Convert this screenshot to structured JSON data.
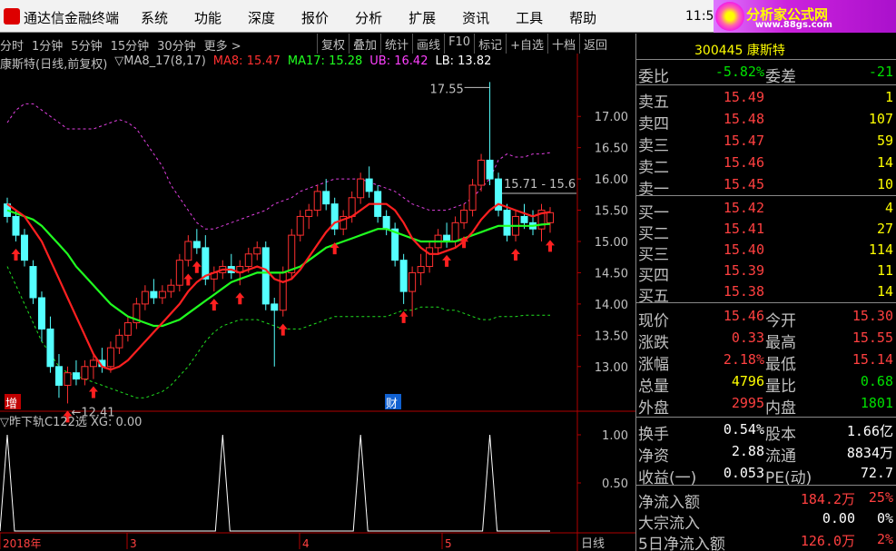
{
  "titlebar": {
    "app_title": "通达信金融终端",
    "menu": [
      "系统",
      "功能",
      "深度",
      "报价",
      "分析",
      "扩展",
      "资讯",
      "工具",
      "帮助"
    ],
    "clock": "11:5",
    "brand_name": "分析家公式网",
    "brand_url": "www.88gs.com"
  },
  "toolbar": {
    "periods": [
      "分时",
      "1分钟",
      "5分钟",
      "15分钟",
      "30分钟",
      "更多 >"
    ],
    "buttons": [
      "复权",
      "叠加",
      "统计",
      "画线",
      "F10",
      "标记",
      "+自选",
      "十档",
      "返回"
    ]
  },
  "legend": {
    "stock": "康斯特(日线,前复权)",
    "indicator": "▽MA8_17(8,17)",
    "ma8": "MA8: 15.47",
    "ma17": "MA17: 15.28",
    "ub": "UB: 16.42",
    "lb": "LB: 13.82"
  },
  "chart": {
    "price_ticks": [
      "17.00",
      "16.50",
      "16.00",
      "15.50",
      "15.00",
      "14.50",
      "14.00",
      "13.50",
      "13.00"
    ],
    "high_label": "17.55",
    "low_label": "12.41",
    "range_label": "15.71 - 15.6",
    "zeng_tag": "增",
    "cai_tag": "财",
    "sub_legend": "▽昨下轨C122选 XG: 0.00",
    "sub_ticks": [
      "1.00",
      "0.50"
    ],
    "dates": [
      "2018年",
      "3",
      "4",
      "5"
    ],
    "period_label": "日线"
  },
  "chart_data": {
    "type": "candlestick",
    "title": "康斯特(日线,前复权)",
    "ylim": [
      12.3,
      17.7
    ],
    "candles": [
      [
        15.6,
        15.7,
        15.3,
        15.4
      ],
      [
        15.4,
        15.5,
        15.0,
        15.1
      ],
      [
        15.1,
        15.2,
        14.6,
        14.7
      ],
      [
        14.6,
        14.7,
        14.0,
        14.1
      ],
      [
        14.1,
        14.2,
        13.4,
        13.6
      ],
      [
        13.6,
        13.8,
        12.9,
        13.0
      ],
      [
        13.0,
        13.2,
        12.5,
        12.7
      ],
      [
        12.7,
        13.0,
        12.41,
        12.9
      ],
      [
        12.9,
        13.1,
        12.7,
        12.8
      ],
      [
        12.8,
        13.1,
        12.7,
        13.0
      ],
      [
        13.0,
        13.2,
        12.8,
        13.1
      ],
      [
        13.1,
        13.3,
        12.9,
        13.0
      ],
      [
        13.0,
        13.4,
        12.9,
        13.3
      ],
      [
        13.3,
        13.6,
        13.2,
        13.5
      ],
      [
        13.5,
        13.8,
        13.4,
        13.7
      ],
      [
        13.7,
        14.1,
        13.6,
        14.0
      ],
      [
        14.0,
        14.3,
        13.9,
        14.2
      ],
      [
        14.2,
        14.4,
        14.0,
        14.1
      ],
      [
        14.1,
        14.3,
        14.0,
        14.2
      ],
      [
        14.2,
        14.4,
        14.1,
        14.3
      ],
      [
        14.3,
        14.8,
        14.2,
        14.7
      ],
      [
        14.7,
        15.1,
        14.6,
        15.0
      ],
      [
        15.0,
        15.2,
        14.8,
        14.9
      ],
      [
        14.9,
        15.1,
        14.3,
        14.4
      ],
      [
        14.4,
        14.6,
        14.2,
        14.5
      ],
      [
        14.5,
        14.7,
        14.4,
        14.6
      ],
      [
        14.6,
        14.8,
        14.4,
        14.5
      ],
      [
        14.5,
        14.7,
        14.3,
        14.6
      ],
      [
        14.6,
        14.9,
        14.5,
        14.8
      ],
      [
        14.8,
        15.0,
        14.7,
        14.9
      ],
      [
        14.9,
        15.0,
        13.9,
        14.0
      ],
      [
        14.0,
        14.1,
        13.0,
        13.9
      ],
      [
        13.9,
        14.6,
        13.8,
        14.5
      ],
      [
        14.5,
        15.2,
        14.4,
        15.1
      ],
      [
        15.1,
        15.5,
        15.0,
        15.4
      ],
      [
        15.4,
        15.6,
        15.2,
        15.5
      ],
      [
        15.5,
        15.9,
        15.4,
        15.8
      ],
      [
        15.8,
        16.0,
        15.5,
        15.6
      ],
      [
        15.6,
        15.7,
        15.1,
        15.2
      ],
      [
        15.2,
        15.5,
        15.1,
        15.4
      ],
      [
        15.4,
        15.8,
        15.3,
        15.7
      ],
      [
        15.7,
        16.1,
        15.6,
        16.0
      ],
      [
        16.0,
        16.2,
        15.7,
        15.8
      ],
      [
        15.8,
        15.9,
        15.3,
        15.4
      ],
      [
        15.4,
        15.5,
        15.1,
        15.2
      ],
      [
        15.2,
        15.3,
        14.6,
        14.7
      ],
      [
        14.7,
        14.8,
        14.0,
        14.2
      ],
      [
        14.2,
        14.6,
        13.8,
        14.5
      ],
      [
        14.5,
        14.8,
        14.3,
        14.6
      ],
      [
        14.6,
        15.0,
        14.5,
        14.9
      ],
      [
        14.9,
        15.2,
        14.8,
        15.1
      ],
      [
        15.1,
        15.3,
        14.9,
        15.0
      ],
      [
        15.0,
        15.4,
        14.9,
        15.3
      ],
      [
        15.3,
        15.6,
        15.2,
        15.5
      ],
      [
        15.5,
        16.0,
        15.4,
        15.9
      ],
      [
        15.9,
        16.4,
        15.8,
        16.3
      ],
      [
        16.3,
        17.55,
        15.9,
        16.0
      ],
      [
        16.0,
        16.1,
        15.4,
        15.5
      ],
      [
        15.5,
        15.6,
        15.0,
        15.1
      ],
      [
        15.1,
        15.5,
        15.0,
        15.4
      ],
      [
        15.4,
        15.6,
        15.2,
        15.3
      ],
      [
        15.3,
        15.5,
        15.1,
        15.2
      ],
      [
        15.2,
        15.6,
        15.0,
        15.5
      ],
      [
        15.3,
        15.55,
        15.14,
        15.46
      ]
    ],
    "series": [
      {
        "name": "MA8",
        "values": [
          15.6,
          15.5,
          15.4,
          15.2,
          15.0,
          14.7,
          14.4,
          14.1,
          13.8,
          13.5,
          13.2,
          13.0,
          12.95,
          13.0,
          13.1,
          13.25,
          13.4,
          13.55,
          13.7,
          13.85,
          14.0,
          14.2,
          14.35,
          14.45,
          14.5,
          14.55,
          14.55,
          14.5,
          14.55,
          14.6,
          14.55,
          14.4,
          14.35,
          14.4,
          14.55,
          14.75,
          14.95,
          15.15,
          15.3,
          15.35,
          15.4,
          15.5,
          15.6,
          15.6,
          15.6,
          15.5,
          15.3,
          15.05,
          14.9,
          14.8,
          14.8,
          14.85,
          14.9,
          15.0,
          15.15,
          15.35,
          15.5,
          15.6,
          15.55,
          15.5,
          15.45,
          15.4,
          15.45,
          15.47
        ]
      },
      {
        "name": "MA17",
        "values": [
          15.5,
          15.45,
          15.4,
          15.35,
          15.25,
          15.1,
          14.95,
          14.8,
          14.6,
          14.45,
          14.3,
          14.15,
          14.0,
          13.9,
          13.8,
          13.75,
          13.7,
          13.65,
          13.65,
          13.7,
          13.75,
          13.85,
          13.95,
          14.05,
          14.15,
          14.25,
          14.35,
          14.4,
          14.45,
          14.5,
          14.5,
          14.5,
          14.5,
          14.55,
          14.6,
          14.7,
          14.8,
          14.9,
          14.95,
          15.0,
          15.05,
          15.1,
          15.15,
          15.2,
          15.2,
          15.15,
          15.1,
          15.05,
          15.0,
          15.0,
          15.0,
          15.0,
          15.0,
          15.05,
          15.1,
          15.15,
          15.2,
          15.25,
          15.25,
          15.25,
          15.25,
          15.25,
          15.27,
          15.28
        ]
      },
      {
        "name": "UB",
        "values": [
          16.9,
          17.1,
          17.2,
          17.2,
          17.1,
          17.0,
          16.9,
          16.8,
          16.8,
          16.8,
          16.8,
          16.85,
          16.9,
          16.95,
          16.9,
          16.8,
          16.6,
          16.4,
          16.2,
          15.9,
          15.7,
          15.5,
          15.3,
          15.2,
          15.2,
          15.25,
          15.3,
          15.35,
          15.4,
          15.45,
          15.5,
          15.6,
          15.65,
          15.7,
          15.8,
          15.85,
          15.9,
          15.95,
          16.0,
          16.0,
          16.0,
          16.0,
          15.95,
          15.9,
          15.85,
          15.8,
          15.7,
          15.6,
          15.55,
          15.5,
          15.5,
          15.5,
          15.55,
          15.6,
          15.7,
          15.85,
          16.0,
          16.3,
          16.4,
          16.35,
          16.35,
          16.4,
          16.4,
          16.42
        ]
      },
      {
        "name": "LB",
        "values": [
          14.6,
          14.3,
          14.0,
          13.7,
          13.4,
          13.2,
          13.0,
          12.9,
          12.85,
          12.8,
          12.75,
          12.7,
          12.65,
          12.6,
          12.55,
          12.5,
          12.5,
          12.55,
          12.6,
          12.7,
          12.85,
          13.0,
          13.2,
          13.4,
          13.55,
          13.65,
          13.7,
          13.75,
          13.75,
          13.75,
          13.7,
          13.65,
          13.6,
          13.6,
          13.6,
          13.65,
          13.7,
          13.75,
          13.8,
          13.8,
          13.8,
          13.8,
          13.8,
          13.8,
          13.8,
          13.85,
          13.9,
          13.9,
          13.95,
          13.95,
          13.95,
          13.9,
          13.9,
          13.85,
          13.8,
          13.75,
          13.75,
          13.8,
          13.8,
          13.8,
          13.82,
          13.82,
          13.82,
          13.82
        ]
      }
    ],
    "buy_signals": [
      1,
      7,
      10,
      21,
      22,
      24,
      27,
      32,
      38,
      46,
      51,
      53,
      59,
      63
    ],
    "sub_signals": [
      0,
      25,
      41,
      56
    ]
  },
  "quote": {
    "code": "300445 康斯特",
    "weibi_label": "委比",
    "weibi": "-5.82%",
    "weicha_label": "委差",
    "weicha": "-21",
    "sells": [
      {
        "label": "卖五",
        "price": "15.49",
        "vol": "1"
      },
      {
        "label": "卖四",
        "price": "15.48",
        "vol": "107"
      },
      {
        "label": "卖三",
        "price": "15.47",
        "vol": "59"
      },
      {
        "label": "卖二",
        "price": "15.46",
        "vol": "14"
      },
      {
        "label": "卖一",
        "price": "15.45",
        "vol": "10"
      }
    ],
    "buys": [
      {
        "label": "买一",
        "price": "15.42",
        "vol": "4"
      },
      {
        "label": "买二",
        "price": "15.41",
        "vol": "27"
      },
      {
        "label": "买三",
        "price": "15.40",
        "vol": "114"
      },
      {
        "label": "买四",
        "price": "15.39",
        "vol": "11"
      },
      {
        "label": "买五",
        "price": "15.38",
        "vol": "14"
      }
    ],
    "stats": [
      {
        "l1": "现价",
        "v1": "15.46",
        "c1": "red",
        "l2": "今开",
        "v2": "15.30",
        "c2": "red"
      },
      {
        "l1": "涨跌",
        "v1": "0.33",
        "c1": "red",
        "l2": "最高",
        "v2": "15.55",
        "c2": "red"
      },
      {
        "l1": "涨幅",
        "v1": "2.18%",
        "c1": "red",
        "l2": "最低",
        "v2": "15.14",
        "c2": "red"
      },
      {
        "l1": "总量",
        "v1": "4796",
        "c1": "yellow",
        "l2": "量比",
        "v2": "0.68",
        "c2": "green"
      },
      {
        "l1": "外盘",
        "v1": "2995",
        "c1": "red",
        "l2": "内盘",
        "v2": "1801",
        "c2": "green"
      }
    ],
    "fundamentals": [
      {
        "l1": "换手",
        "v1": "0.54%",
        "l2": "股本",
        "v2": "1.66亿"
      },
      {
        "l1": "净资",
        "v1": "2.88",
        "l2": "流通",
        "v2": "8834万"
      },
      {
        "l1": "收益(一)",
        "v1": "0.053",
        "l2": "PE(动)",
        "v2": "72.7"
      }
    ],
    "flows": [
      {
        "label": "净流入额",
        "value": "184.2万",
        "pct": "25%",
        "color": "red"
      },
      {
        "label": "大宗流入",
        "value": "0.00",
        "pct": "0%",
        "color": "white"
      },
      {
        "label": "5日净流入额",
        "value": "126.0万",
        "pct": "2%",
        "color": "red"
      }
    ]
  }
}
